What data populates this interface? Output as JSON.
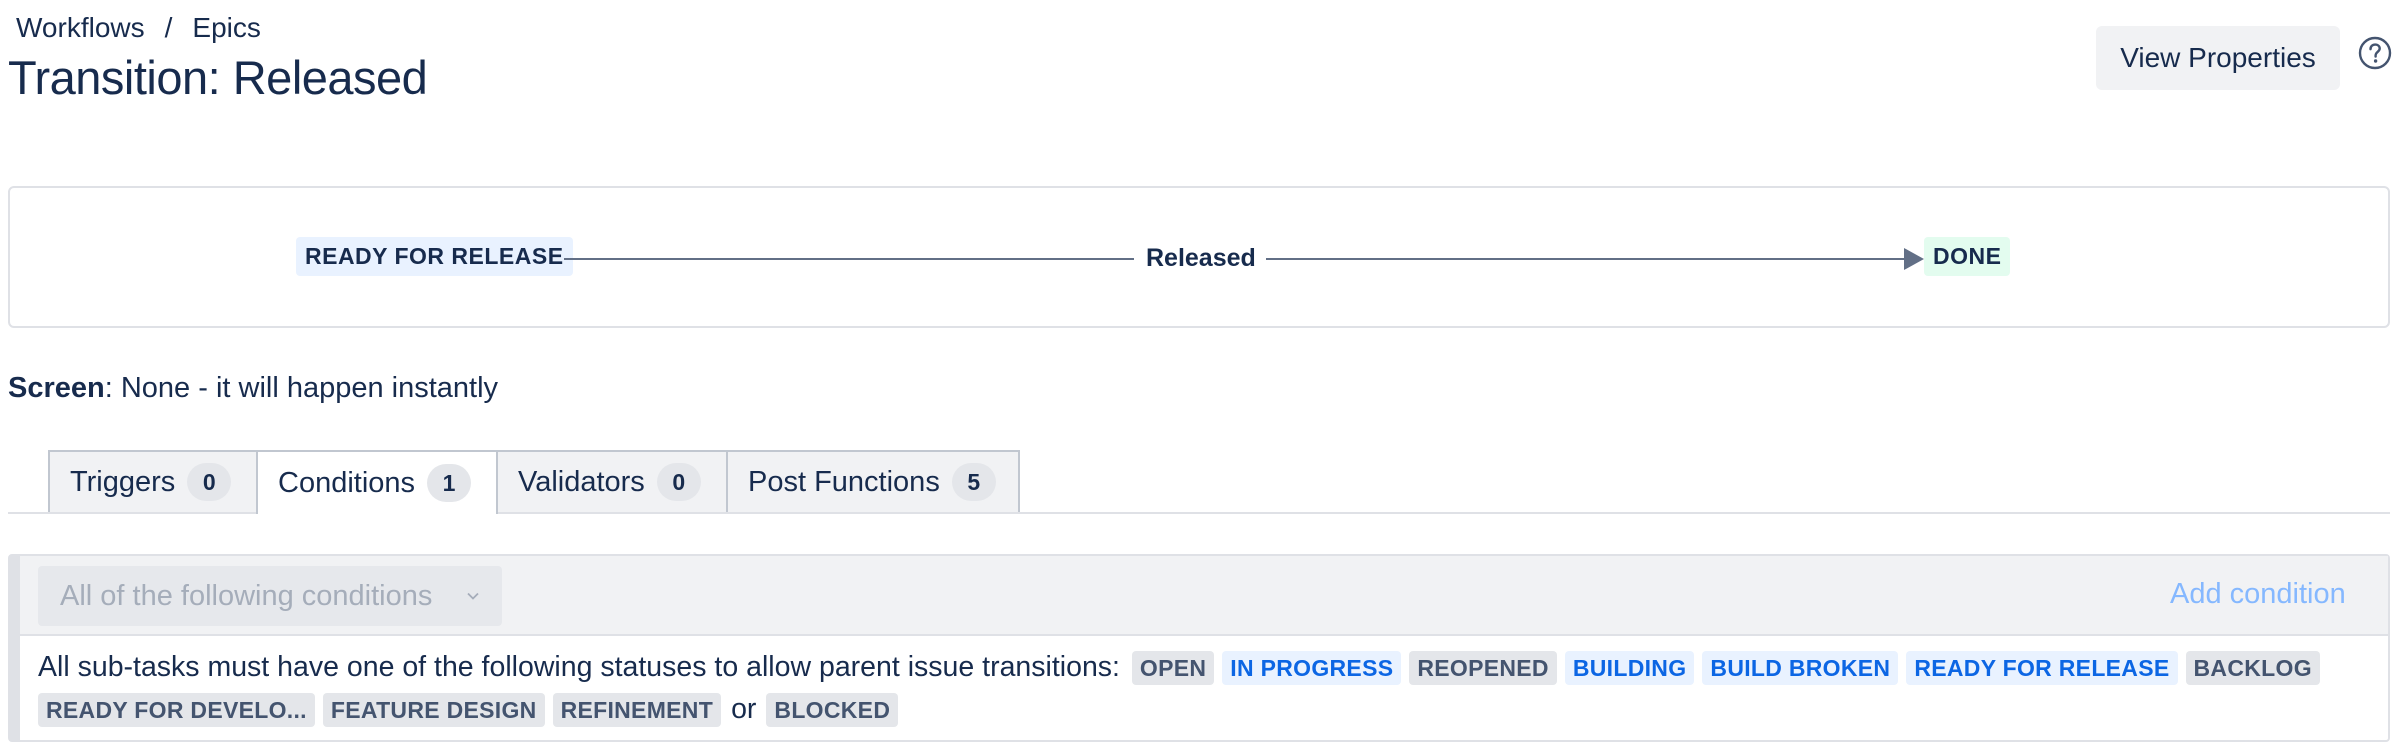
{
  "breadcrumb": {
    "items": [
      "Workflows",
      "Epics"
    ],
    "separator": "/"
  },
  "page": {
    "title": "Transition: Released"
  },
  "header": {
    "view_properties_label": "View Properties",
    "help_icon": "question-circle-icon"
  },
  "diagram": {
    "from_status": "READY FOR RELEASE",
    "transition_name": "Released",
    "to_status": "DONE"
  },
  "screen": {
    "label": "Screen",
    "value": ": None - it will happen instantly"
  },
  "tabs": [
    {
      "label": "Triggers",
      "count": "0",
      "active": false
    },
    {
      "label": "Conditions",
      "count": "1",
      "active": true
    },
    {
      "label": "Validators",
      "count": "0",
      "active": false
    },
    {
      "label": "Post Functions",
      "count": "5",
      "active": false
    }
  ],
  "conditions": {
    "group_select": "All of the following conditions",
    "add_label": "Add condition",
    "description": "All sub-tasks must have one of the following statuses to allow parent issue transitions:",
    "statuses": [
      {
        "text": "OPEN",
        "style": "grey"
      },
      {
        "text": "IN PROGRESS",
        "style": "blue"
      },
      {
        "text": "REOPENED",
        "style": "grey"
      },
      {
        "text": "BUILDING",
        "style": "blue"
      },
      {
        "text": "BUILD BROKEN",
        "style": "blue"
      },
      {
        "text": "READY FOR RELEASE",
        "style": "blue"
      },
      {
        "text": "BACKLOG",
        "style": "grey"
      },
      {
        "text": "READY FOR DEVELO...",
        "style": "grey"
      },
      {
        "text": "FEATURE DESIGN",
        "style": "grey"
      },
      {
        "text": "REFINEMENT",
        "style": "grey"
      },
      {
        "text": "BLOCKED",
        "style": "grey"
      }
    ],
    "or_word": "or"
  },
  "colors": {
    "text": "#172b4d",
    "blue_lozenge_text": "#0c66e4",
    "blue_lozenge_bg": "#e9f2ff",
    "grey_lozenge_bg": "#e4e6ea",
    "link": "#85b8ff"
  }
}
